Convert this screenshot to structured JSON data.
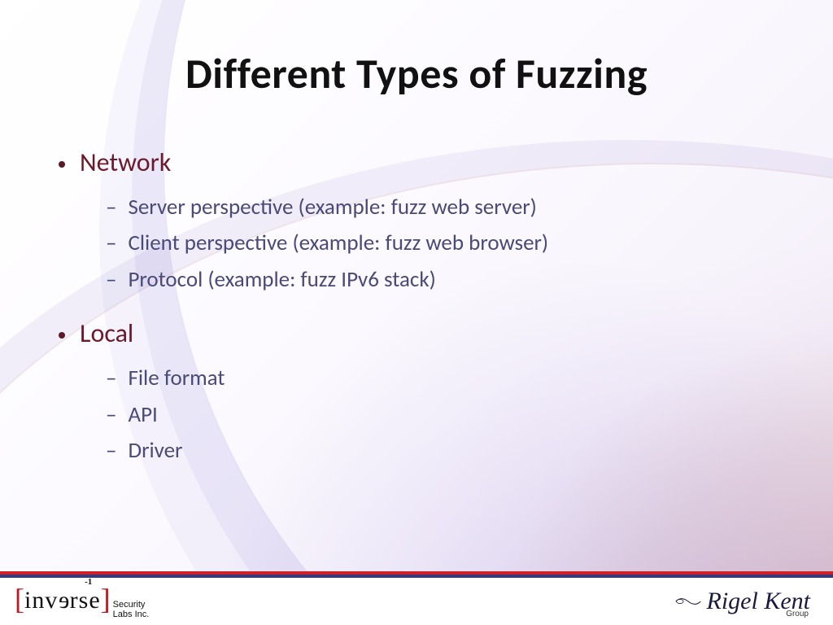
{
  "title": "Different Types of Fuzzing",
  "sections": [
    {
      "heading": "Network",
      "items": [
        "Server perspective (example: fuzz web server)",
        "Client perspective (example: fuzz web browser)",
        "Protocol (example: fuzz IPv6 stack)"
      ]
    },
    {
      "heading": "Local",
      "items": [
        "File format",
        "API",
        "Driver"
      ]
    }
  ],
  "footer": {
    "left_logo": {
      "bracket_open": "[",
      "word_pre": "inv",
      "word_flip": "e",
      "word_post": "rse",
      "bracket_close": "]",
      "exponent": "-1",
      "sub1": "Security",
      "sub2": "Labs Inc."
    },
    "right_logo": {
      "text": "Rigel Kent",
      "sub": "Group"
    }
  }
}
